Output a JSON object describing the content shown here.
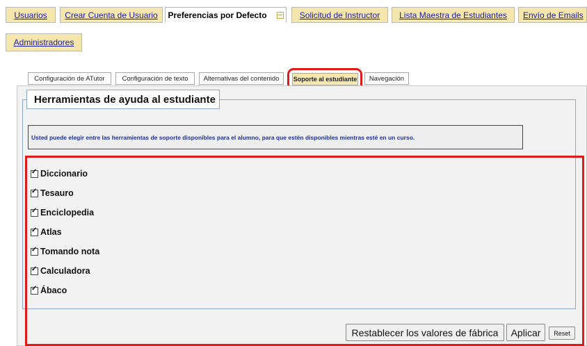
{
  "top_tabs": [
    {
      "label": "Usuarios"
    },
    {
      "label": "Crear Cuenta de Usuario"
    },
    {
      "label": "Preferencias por Defecto"
    },
    {
      "label": "Solicitud de Instructor"
    },
    {
      "label": "Lista Maestra de Estudiantes"
    },
    {
      "label": "Envío de Emails"
    },
    {
      "label": "Administradores"
    }
  ],
  "sub_tabs": [
    {
      "label": "Configuración de ATutor"
    },
    {
      "label": "Configuración de texto"
    },
    {
      "label": "Alternativas del contenido"
    },
    {
      "label": "Soporte al estudiante"
    },
    {
      "label": "Navegación"
    }
  ],
  "section": {
    "title": "Herramientas de ayuda al estudiante",
    "info": "Usted puede elegir entre las herramientas de soporte disponibles para el alumno, para que estén disponibles mientras esté en un curso."
  },
  "options": [
    {
      "label": "Diccionario",
      "checked": true
    },
    {
      "label": "Tesauro",
      "checked": true
    },
    {
      "label": "Enciclopedia",
      "checked": true
    },
    {
      "label": "Atlas",
      "checked": true
    },
    {
      "label": "Tomando nota",
      "checked": true
    },
    {
      "label": "Calculadora",
      "checked": true
    },
    {
      "label": "Ábaco",
      "checked": true
    }
  ],
  "buttons": {
    "restore": "Restablecer los valores de fábrica",
    "apply": "Aplicar",
    "reset": "Reset"
  },
  "colors": {
    "tab_bg": "#f5e6ae",
    "highlight": "#e01a1a",
    "link": "#1a1aa6",
    "info_text": "#1c2fa6"
  }
}
